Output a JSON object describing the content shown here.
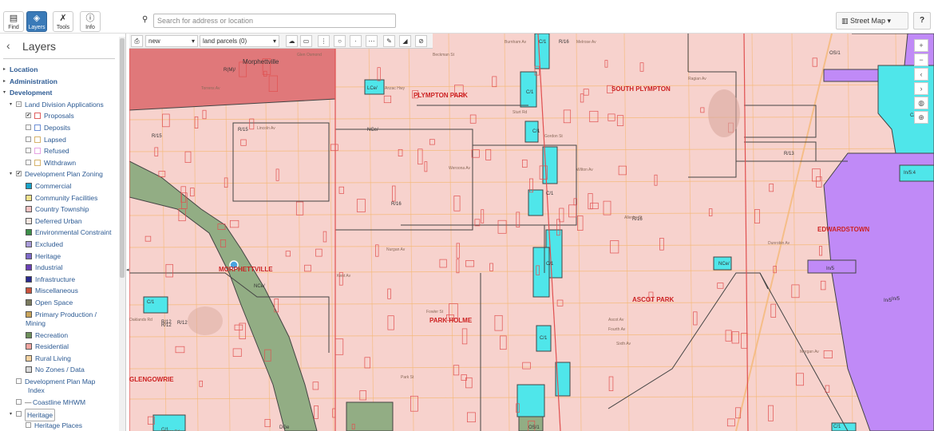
{
  "toolbar": {
    "find": "Find",
    "layers": "Layers",
    "tools": "Tools",
    "info": "Info",
    "search_placeholder": "Search for address or location",
    "basemap": "Street Map ▾",
    "help": "?"
  },
  "sidebar": {
    "title": "Layers",
    "groups": [
      "Location",
      "Administration",
      "Development"
    ],
    "land_division": "Land Division Applications",
    "land_division_items": [
      "Proposals",
      "Deposits",
      "Lapsed",
      "Refused",
      "Withdrawn"
    ],
    "zoning": "Development Plan Zoning",
    "zoning_items": [
      "Commercial",
      "Community Facilities",
      "Country Township",
      "Deferred Urban",
      "Environmental Constraint",
      "Excluded",
      "Heritage",
      "Industrial",
      "Infrastructure",
      "Miscellaneous",
      "Open Space",
      "Primary Production /",
      "Recreation",
      "Residential",
      "Rural Living",
      "No Zones / Data"
    ],
    "zoning_item_line2": "Mining",
    "map_index": "Development Plan Map",
    "map_index_line2": "Index",
    "coastline": "Coastline MHWM",
    "heritage": "Heritage",
    "heritage_places": "Heritage Places",
    "colors": {
      "commercial": "#1aa3c9",
      "community": "#f2e28c",
      "country": "#f7c3c3",
      "deferred": "#f6e7e0",
      "environmental": "#3d8f4a",
      "excluded": "#a99bd9",
      "heritage": "#7e69c9",
      "industrial": "#6a3fb5",
      "infrastructure": "#2a2a8f",
      "misc": "#c9523d",
      "openspace": "#7a7a5e",
      "primary": "#c9a45a",
      "recreation": "#6d8f5a",
      "residential": "#f2a5a0",
      "rural": "#f4d2a0",
      "nozone": "#d9d9d9",
      "ld_proposals": "#e06060",
      "ld_deposits": "#6c8fd6",
      "ld_lapsed": "#d6b36c",
      "ld_refused": "#e7a3e3",
      "ld_withdrawn": "#d6b36c"
    }
  },
  "map_toolbar": {
    "print": "⎙",
    "layer_select": "new",
    "feature_select": "land parcels (0)"
  },
  "map": {
    "suburbs": [
      "Morphettville",
      "PLYMPTON PARK",
      "SOUTH PLYMPTON",
      "MORPHETTVILLE",
      "PARK HOLME",
      "ASCOT PARK",
      "EDWARDSTOWN",
      "GLENGOWRIE"
    ],
    "zones": [
      "R(M)/",
      "R/15",
      "R/15",
      "R/16",
      "R/16",
      "R/13",
      "R/12",
      "R/12",
      "R/12",
      "LCe/",
      "C/1",
      "C/1",
      "NCe/",
      "C/1",
      "C/1",
      "C/1",
      "C/1",
      "C/1",
      "NCe/",
      "NCe/",
      "OS/1",
      "In/5",
      "In/5",
      "In/5",
      "In/5:4",
      "C/2",
      "DGe",
      "OS/1",
      "C/1",
      "R/16",
      "C/1"
    ],
    "streets": [
      "Anzac Hwy",
      "Beckman St",
      "Ragian Av",
      "Weroona Av",
      "Gordon St",
      "Wilton Av",
      "Kent Av",
      "Glen Osmond",
      "Burnham Av",
      "Melrose Av",
      "Torrens Av",
      "Lincoln Av",
      "Oaklands Rd",
      "Nurgan Av",
      "Allenby St",
      "Dunrobin Av",
      "Park St",
      "Fowler St",
      "Sixth Av",
      "Fourth Av",
      "Ascot Av",
      "Morgan Av",
      "Sturt Rd",
      "Marion Rd"
    ],
    "colors": {
      "residential": "#f7d2cd",
      "commercial": "#4fe6ea",
      "industrial": "#c08af7",
      "openspace": "#92ad84",
      "misc": "#e0787a",
      "boundary": "#444444",
      "parcel": "#e05050",
      "road": "#f5b977"
    }
  },
  "controls": {
    "zoom_in": "+",
    "zoom_out": "−",
    "back": "‹",
    "forward": "›",
    "globe": "◍",
    "zoom_box": "⊕"
  }
}
